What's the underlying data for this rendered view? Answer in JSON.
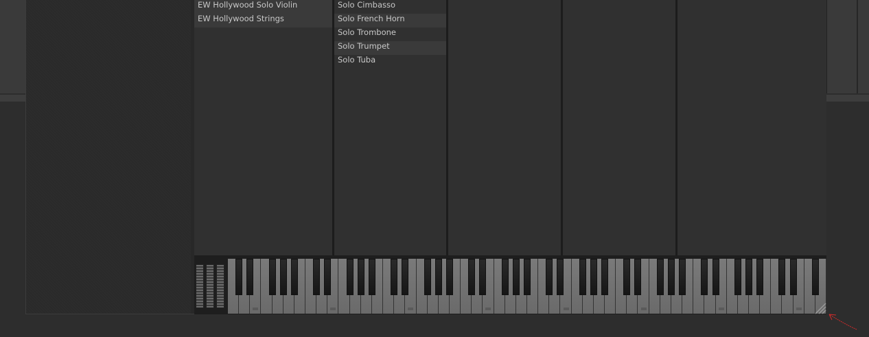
{
  "instrument_browser": {
    "libraries": [
      {
        "label": "EW Hollywood Solo Violin"
      },
      {
        "label": "EW Hollywood Strings"
      }
    ],
    "instruments": [
      {
        "label": "Solo Cimbasso"
      },
      {
        "label": "Solo French Horn"
      },
      {
        "label": "Solo Trombone"
      },
      {
        "label": "Solo Trumpet"
      },
      {
        "label": "Solo Tuba"
      }
    ]
  },
  "keyboard": {
    "white_key_count": 54
  },
  "colors": {
    "annotation": "#d22b2b"
  }
}
